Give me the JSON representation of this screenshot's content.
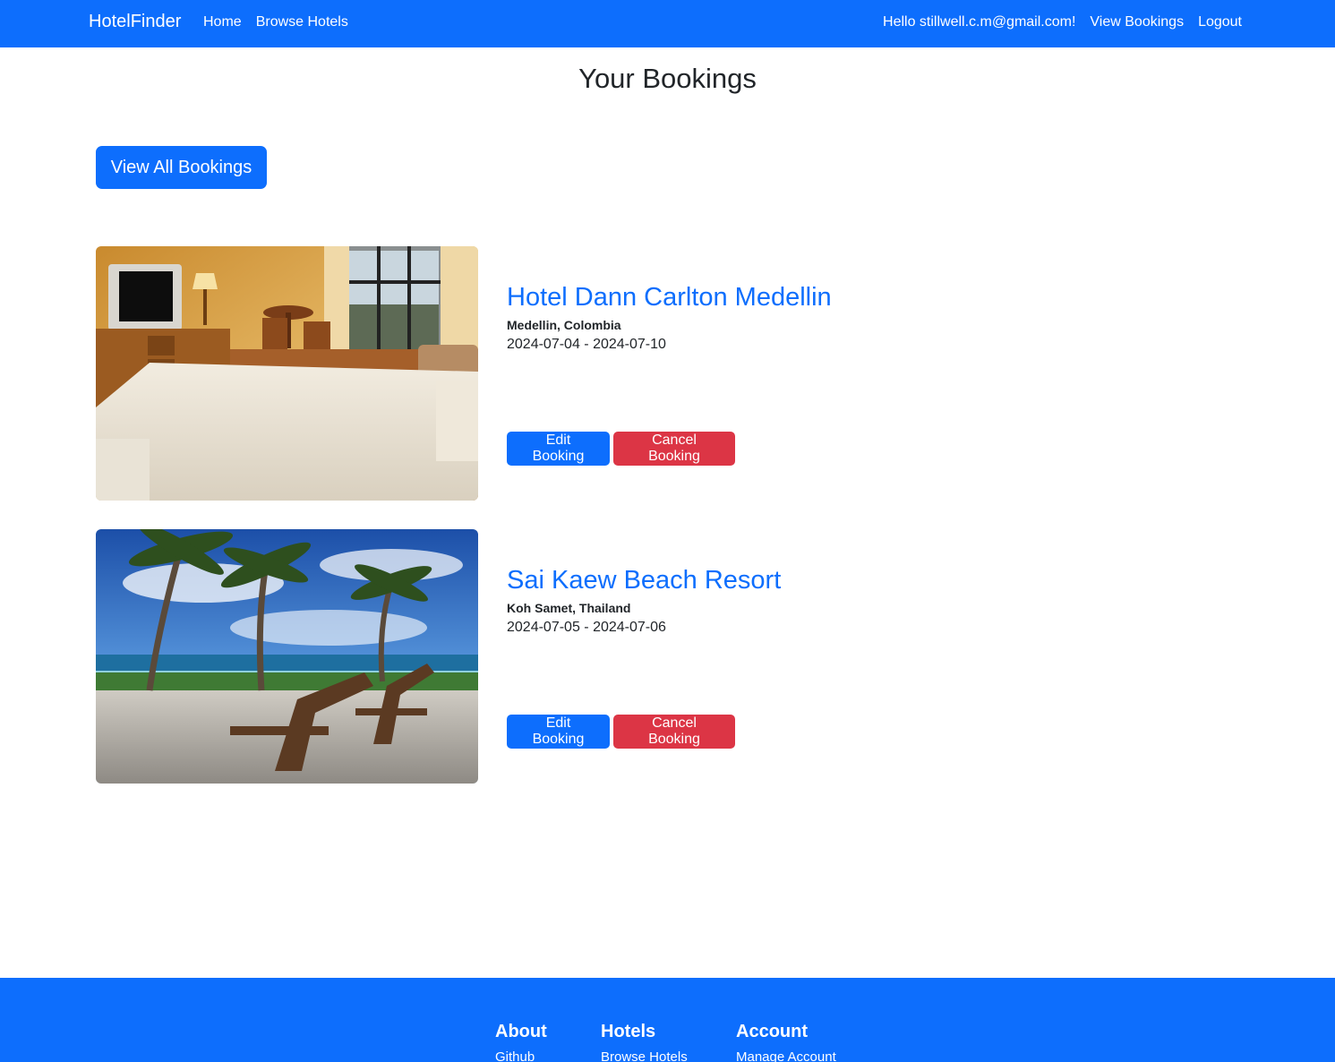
{
  "nav": {
    "brand": "HotelFinder",
    "links": [
      "Home",
      "Browse Hotels"
    ],
    "greeting": "Hello stillwell.c.m@gmail.com!",
    "view_bookings": "View Bookings",
    "logout": "Logout"
  },
  "main": {
    "title": "Your Bookings",
    "view_all_label": "View All Bookings",
    "bookings": [
      {
        "name": "Hotel Dann Carlton Medellin",
        "location": "Medellin, Colombia",
        "dates": "2024-07-04 - 2024-07-10",
        "edit_label": "Edit Booking",
        "cancel_label": "Cancel Booking"
      },
      {
        "name": "Sai Kaew Beach Resort",
        "location": "Koh Samet, Thailand",
        "dates": "2024-07-05 - 2024-07-06",
        "edit_label": "Edit Booking",
        "cancel_label": "Cancel Booking"
      }
    ]
  },
  "footer": {
    "about": {
      "heading": "About",
      "link": "Github"
    },
    "hotels": {
      "heading": "Hotels",
      "link": "Browse Hotels"
    },
    "account": {
      "heading": "Account",
      "link": "Manage Account"
    }
  },
  "colors": {
    "primary": "#0d6efd",
    "danger": "#dc3545"
  }
}
